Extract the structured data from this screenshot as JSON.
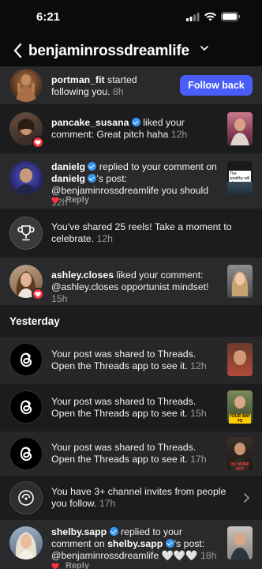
{
  "status": {
    "time": "6:21"
  },
  "header": {
    "title": "benjaminrossdreamlife"
  },
  "section_yesterday": "Yesterday",
  "items": [
    {
      "user": "portman_fit",
      "text": " started following you.",
      "time": "8h",
      "button": "Follow back"
    },
    {
      "user": "pancake_susana",
      "text": " liked your comment: Great pitch haha",
      "time": "12h"
    },
    {
      "user": "danielg",
      "text_a": " replied to your comment on ",
      "user2": "danielg",
      "text_b": "'s post: @benjaminrossdreamlife you should",
      "time": "12h",
      "reply": "Reply"
    },
    {
      "text": "You've shared 25 reels! Take a moment to celebrate.",
      "time": "12h"
    },
    {
      "user": "ashley.closes",
      "text": " liked your comment: @ashley.closes opportunist mindset!",
      "time": "15h"
    },
    {
      "text": "Your post was shared to Threads. Open the Threads app to see it.",
      "time": "12h"
    },
    {
      "text": "Your post was shared to Threads. Open the Threads app to see it.",
      "time": "15h"
    },
    {
      "text": "Your post was shared to Threads. Open the Threads app to see it.",
      "time": "17h"
    },
    {
      "text": "You have 3+ channel invites from people you follow.",
      "time": "17h"
    },
    {
      "user": "shelby.sapp",
      "text_a": " replied to your comment on ",
      "user2": "shelby.sapp",
      "text_b": "'s post: @benjaminrossdreamlife 🤍🤍🤍",
      "time": "18h",
      "reply": "Reply"
    }
  ],
  "thumb_captions": {
    "t2": "The wealthy will always recruit",
    "t6": "YOUR WAY TO",
    "t7": "DO WORK OUT"
  },
  "colors": {
    "accent": "#4a5df9",
    "verified": "#3797f0",
    "heart": "#ff3040"
  }
}
